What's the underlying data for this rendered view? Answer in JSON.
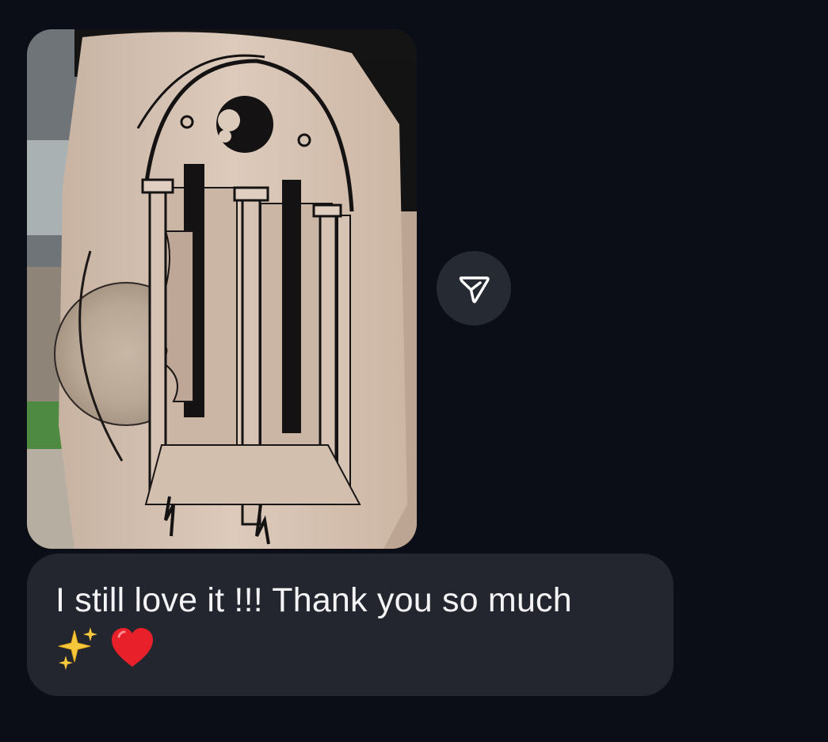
{
  "conversation": {
    "photo_message": {
      "image": "tattoo photo on upper arm: gothic arched window with a face in profile, a sun and columns"
    },
    "share_button": {
      "icon": "send-icon"
    },
    "text_message": {
      "text": "I still love it !!! Thank you so much",
      "emojis": [
        "sparkles-emoji",
        "red-heart-emoji"
      ]
    }
  },
  "colors": {
    "background": "#0b0e17",
    "bubble": "#23262e",
    "share_button": "#262a33",
    "text": "#f4f4f6"
  }
}
